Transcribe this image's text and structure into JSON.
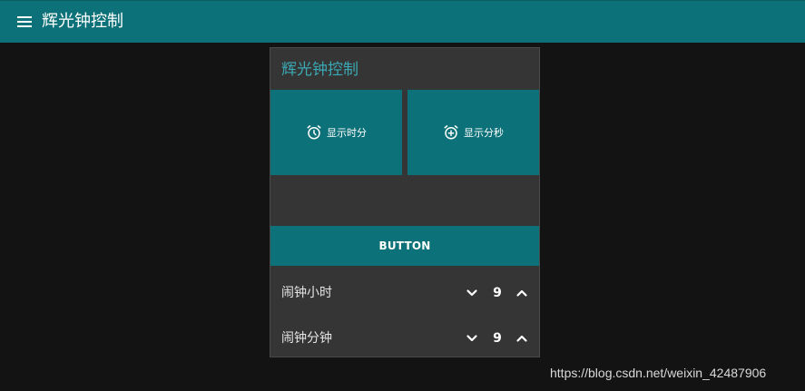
{
  "header": {
    "title": "辉光钟控制",
    "menu_icon": "hamburger-menu-icon"
  },
  "card": {
    "title": "辉光钟控制",
    "tiles": [
      {
        "label": "显示时分",
        "icon": "alarm-clock-icon"
      },
      {
        "label": "显示分秒",
        "icon": "alarm-add-icon"
      }
    ],
    "button_label": "BUTTON",
    "rows": [
      {
        "label": "闹钟小时",
        "value": "9"
      },
      {
        "label": "闹钟分钟",
        "value": "9"
      }
    ]
  },
  "watermark": "https://blog.csdn.net/weixin_42487906",
  "colors": {
    "accent": "#0c7178",
    "title_accent": "#3aa9b4",
    "background": "#131313",
    "card": "#353535"
  }
}
